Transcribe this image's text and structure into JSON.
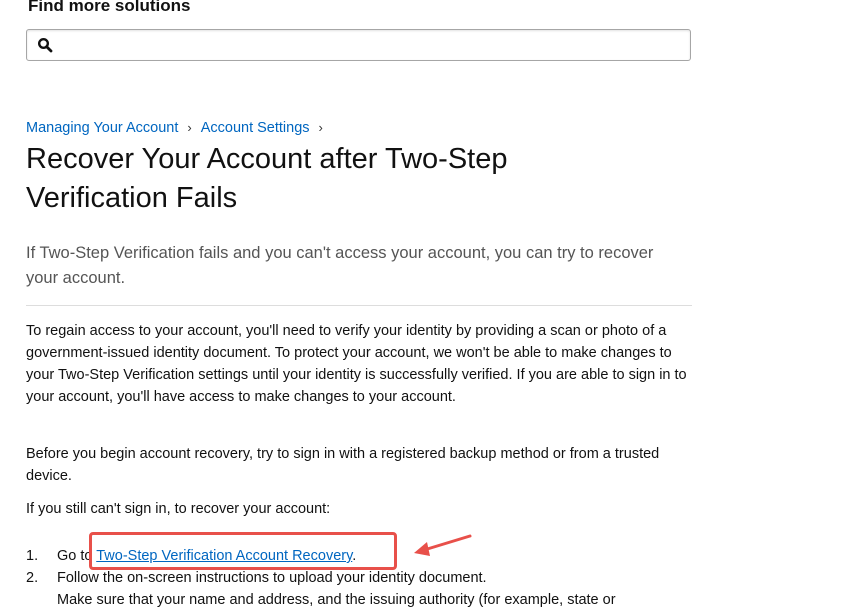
{
  "search": {
    "title": "Find more solutions",
    "placeholder": "",
    "value": ""
  },
  "breadcrumb": {
    "items": [
      "Managing Your Account",
      "Account Settings"
    ],
    "separator": "›"
  },
  "article": {
    "title": "Recover Your Account after Two-Step Verification Fails",
    "intro": "If Two-Step Verification fails and you can't access your account, you can try to recover your account.",
    "para1": "To regain access to your account, you'll need to verify your identity by providing a scan or photo of a government-issued identity document. To protect your account, we won't be able to make changes to your Two-Step Verification settings until your identity is successfully verified. If you are able to sign in to your account, you'll have access to make changes to your account.",
    "para2": "Before you begin account recovery, try to sign in with a registered backup method or from a trusted device.",
    "para3": "If you still can't sign in, to recover your account:",
    "steps": [
      {
        "number": "1.",
        "prefix": "Go to ",
        "link": "Two-Step Verification Account Recovery",
        "suffix": "."
      },
      {
        "number": "2.",
        "text": "Follow the on-screen instructions to upload your identity document.",
        "sub": "Make sure that your name and address, and the issuing authority (for example, state or"
      }
    ]
  },
  "colors": {
    "link": "#0066c0",
    "annotation": "#e8504a",
    "intro_text": "#555555"
  },
  "icons": [
    "search-icon",
    "arrow-icon"
  ]
}
